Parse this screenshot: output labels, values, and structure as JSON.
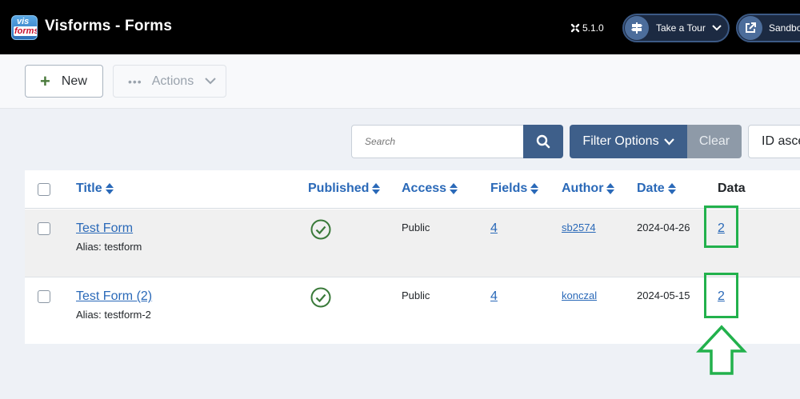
{
  "header": {
    "logo_text_top": "vis",
    "logo_text_bottom": "forms",
    "title": "Visforms - Forms",
    "version": "5.1.0",
    "take_tour_label": "Take a Tour",
    "sandbox_label": "Sandbox"
  },
  "toolbar": {
    "new_label": "New",
    "actions_label": "Actions"
  },
  "filter": {
    "search_placeholder": "Search",
    "filter_options_label": "Filter Options",
    "clear_label": "Clear",
    "sort_label": "ID ascending"
  },
  "table": {
    "headers": {
      "title": "Title",
      "published": "Published",
      "access": "Access",
      "fields": "Fields",
      "author": "Author",
      "date": "Date",
      "data": "Data"
    },
    "rows": [
      {
        "title": "Test Form",
        "alias": "Alias: testform",
        "published": true,
        "access": "Public",
        "fields": "4",
        "author": "sb2574",
        "date": "2024-04-26",
        "data": "2"
      },
      {
        "title": "Test Form (2)",
        "alias": "Alias: testform-2",
        "published": true,
        "access": "Public",
        "fields": "4",
        "author": "konczal",
        "date": "2024-05-15",
        "data": "2"
      }
    ]
  },
  "colors": {
    "header_bg": "#000000",
    "primary": "#3e5f8a",
    "link": "#2a69b8",
    "published_green": "#3a7a3a",
    "annotation_green": "#22b14c"
  }
}
